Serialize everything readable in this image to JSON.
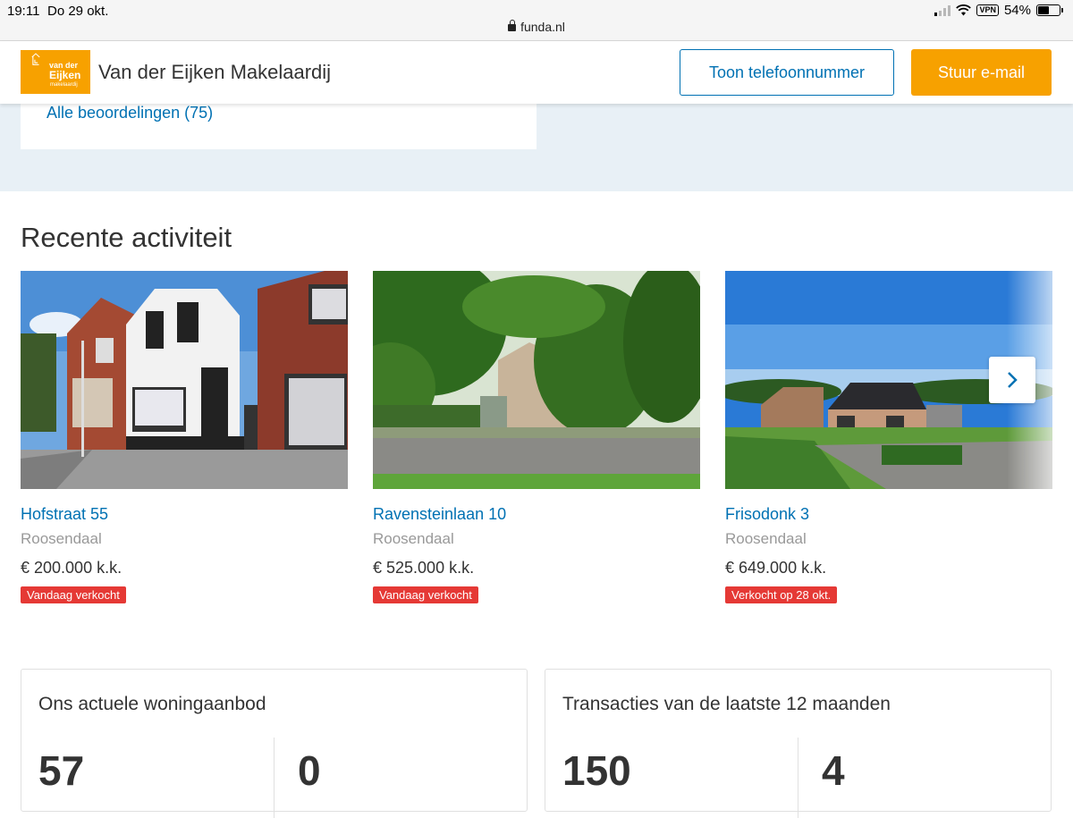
{
  "status_bar": {
    "time": "19:11",
    "date": "Do 29 okt.",
    "battery": "54%",
    "vpn": "VPN",
    "url": "funda.nl"
  },
  "header": {
    "brand_name": "Van der Eijken Makelaardij",
    "logo_line1": "van der",
    "logo_line2": "Eijken",
    "logo_line3": "makelaardij",
    "phone_button": "Toon telefoonnummer",
    "mail_button": "Stuur e-mail"
  },
  "reviews": {
    "all_reviews_link": "Alle beoordelingen (75)"
  },
  "recent": {
    "title": "Recente activiteit",
    "listings": [
      {
        "address": "Hofstraat 55",
        "city": "Roosendaal",
        "price": "€ 200.000 k.k.",
        "status": "Vandaag verkocht"
      },
      {
        "address": "Ravensteinlaan 10",
        "city": "Roosendaal",
        "price": "€ 525.000 k.k.",
        "status": "Vandaag verkocht"
      },
      {
        "address": "Frisodonk 3",
        "city": "Roosendaal",
        "price": "€ 649.000 k.k.",
        "status": "Verkocht op 28 okt."
      }
    ]
  },
  "offer": {
    "title": "Ons actuele woningaanbod",
    "count_left": "57",
    "count_right": "0"
  },
  "transactions": {
    "title": "Transacties van de laatste 12 maanden",
    "count_left": "150",
    "count_right": "4"
  },
  "colors": {
    "accent": "#f7a100",
    "link": "#0071b3",
    "sold_badge": "#e53935",
    "band": "#e8f0f6"
  }
}
